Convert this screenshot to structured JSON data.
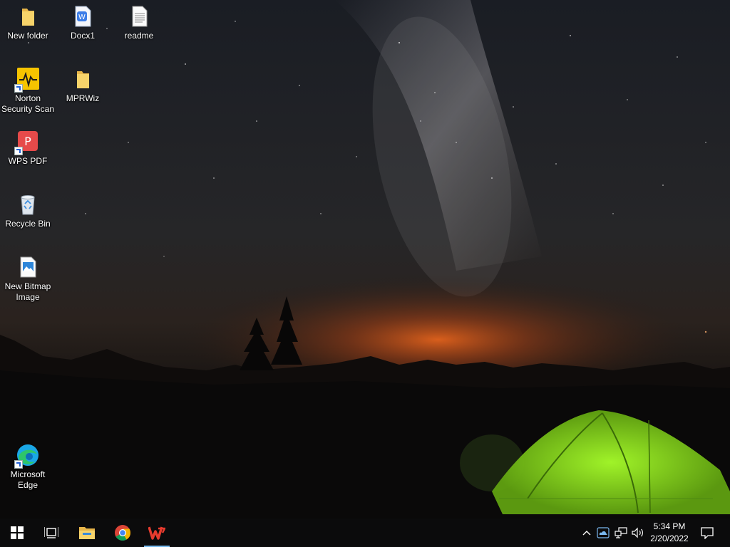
{
  "desktop": {
    "icons": [
      {
        "label": "New folder",
        "icon": "folder-icon"
      },
      {
        "label": "Docx1",
        "icon": "wps-writer-doc-icon"
      },
      {
        "label": "readme",
        "icon": "text-document-icon"
      },
      {
        "label": "Norton Security Scan",
        "icon": "norton-icon"
      },
      {
        "label": "MPRWiz",
        "icon": "folder-icon"
      },
      {
        "label": "WPS PDF",
        "icon": "wps-pdf-icon"
      },
      {
        "label": "Recycle Bin",
        "icon": "recycle-bin-icon"
      },
      {
        "label": "New Bitmap Image",
        "icon": "bitmap-image-icon"
      },
      {
        "label": "Microsoft Edge",
        "icon": "edge-icon"
      }
    ]
  },
  "taskbar": {
    "pinned": [
      {
        "name": "start",
        "icon": "windows-logo-icon"
      },
      {
        "name": "task-view",
        "icon": "task-view-icon"
      },
      {
        "name": "file-explorer",
        "icon": "file-explorer-icon"
      },
      {
        "name": "chrome",
        "icon": "chrome-icon"
      },
      {
        "name": "wps-office",
        "icon": "wps-office-icon",
        "active": true
      }
    ],
    "tray": {
      "icons": [
        "chevron-up-icon",
        "onedrive-icon",
        "network-icon",
        "volume-icon"
      ],
      "time": "5:34 PM",
      "date": "2/20/2022"
    },
    "notification_icon": "action-center-icon"
  },
  "colors": {
    "taskbar_bg": "#0b0b0c",
    "active_indicator": "#76b9ed",
    "tent_green": "#8fdc1f",
    "horizon_glow": "#e2621c"
  }
}
